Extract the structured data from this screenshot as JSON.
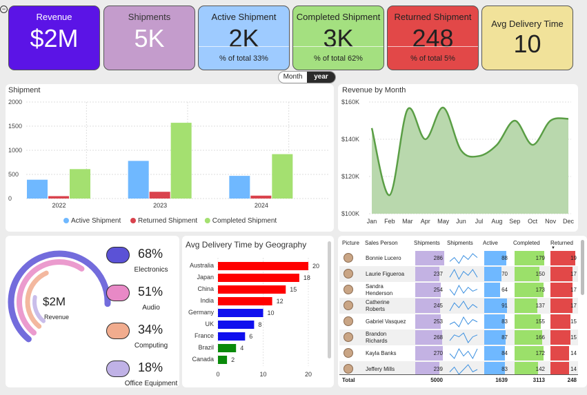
{
  "kpis": {
    "revenue": {
      "title": "Revenue",
      "value": "$2M"
    },
    "shipments": {
      "title": "Shipments",
      "value": "5K"
    },
    "active": {
      "title": "Active Shipment",
      "value": "2K",
      "foot": "% of total 33%"
    },
    "completed": {
      "title": "Completed Shipment",
      "value": "3K",
      "foot": "% of total 62%"
    },
    "returned": {
      "title": "Returned Shipment",
      "value": "248",
      "foot": "% of total 5%"
    },
    "avg_delivery": {
      "title": "Avg Delivery Time",
      "value": "10"
    }
  },
  "colors": {
    "revenue": "#5b14e6",
    "shipments": "#c49ccc",
    "active": "#9ecbff",
    "completed": "#a4e080",
    "returned": "#e24848",
    "avg": "#f1e29a",
    "bar_active": "#6fb8ff",
    "bar_returned": "#d9434d",
    "bar_completed": "#a4e070",
    "area_line": "#5a9e45",
    "area_fill": "#b9d8ad",
    "geo_red": "#ff0000",
    "geo_blue": "#1010ee",
    "geo_green": "#0a8a0a"
  },
  "toggle": {
    "month": "Month",
    "year": "year",
    "selected": "year"
  },
  "shipment_chart": {
    "title": "Shipment",
    "chart_data": {
      "type": "bar",
      "categories": [
        "2022",
        "2023",
        "2024"
      ],
      "series": [
        {
          "name": "Active Shipment",
          "values": [
            390,
            780,
            470
          ]
        },
        {
          "name": "Returned Shipment",
          "values": [
            50,
            140,
            60
          ]
        },
        {
          "name": "Completed Shipment",
          "values": [
            610,
            1570,
            920
          ]
        }
      ],
      "yticks": [
        "0",
        "500",
        "1000",
        "1500",
        "2000"
      ],
      "ylim": [
        0,
        2000
      ],
      "legend": "bottom"
    }
  },
  "revenue_chart": {
    "title": "Revenue by Month",
    "chart_data": {
      "type": "area",
      "x": [
        "Jan",
        "Feb",
        "Mar",
        "Apr",
        "May",
        "Jun",
        "Jul",
        "Aug",
        "Sep",
        "Oct",
        "Nov",
        "Dec"
      ],
      "values": [
        146000,
        110000,
        156000,
        140000,
        157000,
        134000,
        131000,
        137000,
        150000,
        137000,
        150000,
        151000
      ],
      "yticks": [
        "$100K",
        "$120K",
        "$140K",
        "$160K"
      ],
      "ylim": [
        100000,
        160000
      ]
    }
  },
  "donut": {
    "center_value": "$2M",
    "center_label": "Revenue",
    "categories": [
      {
        "name": "Electronics",
        "pct": "68%",
        "value": 0.68,
        "color": "#5b52d6"
      },
      {
        "name": "Audio",
        "pct": "51%",
        "value": 0.51,
        "color": "#e889c6"
      },
      {
        "name": "Computing",
        "pct": "34%",
        "value": 0.34,
        "color": "#f1ac8e"
      },
      {
        "name": "Office Equipment",
        "pct": "18%",
        "value": 0.18,
        "color": "#c0b2e6"
      }
    ]
  },
  "geo_chart": {
    "title": "Avg Delivery Time by Geography",
    "chart_data": {
      "type": "bar",
      "orientation": "horizontal",
      "categories": [
        "Australia",
        "Japan",
        "China",
        "India",
        "Germany",
        "UK",
        "France",
        "Brazil",
        "Canada"
      ],
      "values": [
        20,
        18,
        15,
        12,
        10,
        8,
        6,
        4,
        2
      ],
      "xticks": [
        "0",
        "10",
        "20"
      ],
      "xlim": [
        0,
        20
      ]
    }
  },
  "table": {
    "headers": [
      "Picture",
      "Sales Person",
      "Shipments",
      "Shipments",
      "Active",
      "Completed",
      "Returned"
    ],
    "rows": [
      {
        "name": "Bonnie Lucero",
        "shipments": "286",
        "active": "88",
        "completed": "179",
        "returned": "19",
        "spark": [
          5,
          7,
          4,
          8,
          6,
          9,
          7
        ]
      },
      {
        "name": "Laurie Figueroa",
        "shipments": "237",
        "active": "70",
        "completed": "150",
        "returned": "17",
        "spark": [
          4,
          8,
          3,
          7,
          5,
          8,
          4
        ]
      },
      {
        "name": "Sandra Henderson",
        "shipments": "254",
        "active": "64",
        "completed": "173",
        "returned": "17",
        "spark": [
          6,
          3,
          8,
          4,
          7,
          5,
          6
        ]
      },
      {
        "name": "Catherine Roberts",
        "shipments": "245",
        "active": "91",
        "completed": "137",
        "returned": "17",
        "spark": [
          3,
          8,
          5,
          9,
          4,
          7,
          5
        ]
      },
      {
        "name": "Gabriel Vasquez",
        "shipments": "253",
        "active": "83",
        "completed": "155",
        "returned": "15",
        "spark": [
          5,
          6,
          4,
          8,
          5,
          7,
          6
        ]
      },
      {
        "name": "Brandon Richards",
        "shipments": "268",
        "active": "87",
        "completed": "166",
        "returned": "15",
        "spark": [
          4,
          7,
          6,
          8,
          3,
          6,
          7
        ]
      },
      {
        "name": "Kayla Banks",
        "shipments": "270",
        "active": "84",
        "completed": "172",
        "returned": "14",
        "spark": [
          6,
          4,
          8,
          5,
          7,
          4,
          8
        ]
      },
      {
        "name": "Jeffery Mills",
        "shipments": "239",
        "active": "83",
        "completed": "142",
        "returned": "14",
        "spark": [
          5,
          7,
          4,
          6,
          8,
          5,
          6
        ]
      }
    ],
    "total": {
      "label": "Total",
      "shipments": "5000",
      "active": "1639",
      "completed": "3113",
      "returned": "248"
    }
  }
}
